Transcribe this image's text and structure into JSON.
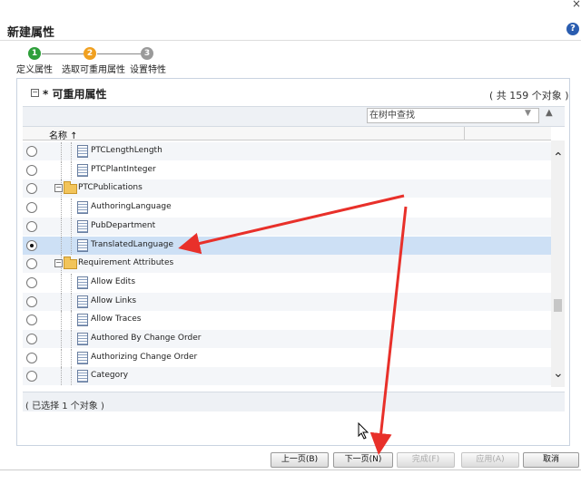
{
  "window": {
    "title": "新建属性",
    "close_glyph": "×",
    "help_glyph": "?"
  },
  "wizard": {
    "steps": [
      {
        "number": "1",
        "label": "定义属性",
        "color": "#2e9f3a"
      },
      {
        "number": "2",
        "label": "选取可重用属性",
        "color": "#f0a020"
      },
      {
        "number": "3",
        "label": "设置特性",
        "color": "#9a9a9a"
      }
    ]
  },
  "panel": {
    "collapse_glyph": "−",
    "title": "* 可重用属性",
    "count": "( 共 159 个对象 )",
    "search_value": "在树中查找",
    "column_name": "名称 ↑",
    "status": "( 已选择 1 个对象 )"
  },
  "rows": [
    {
      "label": "PTCLengthLength",
      "type": "attribute",
      "selected": false
    },
    {
      "label": "PTCPlantInteger",
      "type": "attribute",
      "selected": false
    },
    {
      "label": "PTCPublications",
      "type": "folder",
      "selected": false,
      "expander": "−"
    },
    {
      "label": "AuthoringLanguage",
      "type": "attribute",
      "selected": false
    },
    {
      "label": "PubDepartment",
      "type": "attribute",
      "selected": false
    },
    {
      "label": "TranslatedLanguage",
      "type": "attribute",
      "selected": true
    },
    {
      "label": "Requirement Attributes",
      "type": "folder",
      "selected": false,
      "expander": "−"
    },
    {
      "label": "Allow Edits",
      "type": "attribute",
      "selected": false
    },
    {
      "label": "Allow Links",
      "type": "attribute",
      "selected": false
    },
    {
      "label": "Allow Traces",
      "type": "attribute",
      "selected": false
    },
    {
      "label": "Authored By Change Order",
      "type": "attribute",
      "selected": false
    },
    {
      "label": "Authorizing Change Order",
      "type": "attribute",
      "selected": false
    },
    {
      "label": "Category",
      "type": "attribute",
      "selected": false
    }
  ],
  "buttons": {
    "prev": "上一页(B)",
    "next": "下一页(N)",
    "finish": "完成(F)",
    "apply": "应用(A)",
    "cancel": "取消"
  },
  "colors": {
    "annotation_arrow": "#e8302a",
    "selected_row": "#cde0f5"
  }
}
